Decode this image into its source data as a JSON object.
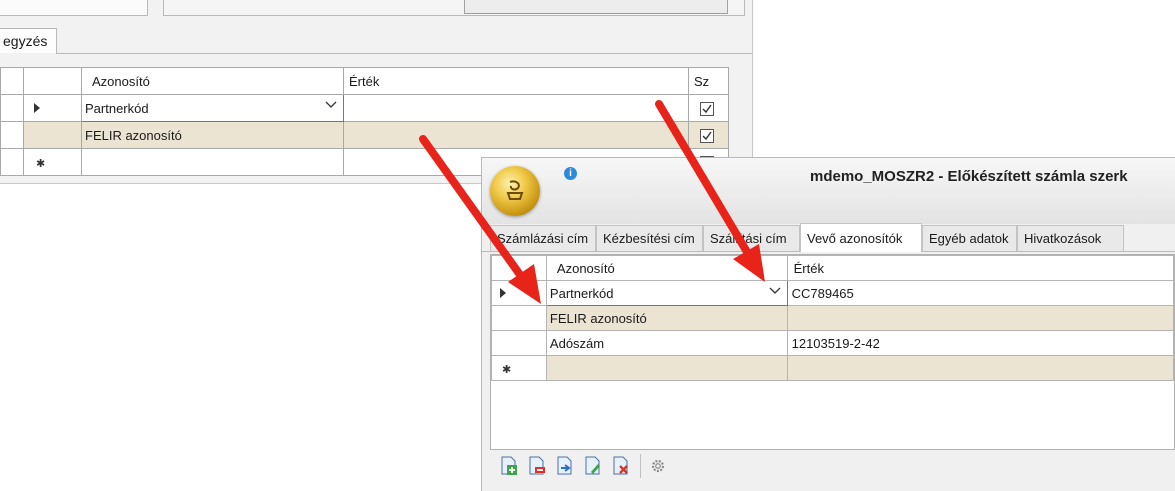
{
  "background_window": {
    "tab_label": "egyzés",
    "columns": {
      "id": "Azonosító",
      "value": "Érték",
      "sz": "Sz"
    },
    "rows": [
      {
        "azonosito": "Partnerkód",
        "ertek": "",
        "sz_checked": true
      },
      {
        "azonosito": "FELIR azonosító",
        "ertek": "",
        "sz_checked": true
      },
      {
        "azonosito": "",
        "ertek": "",
        "sz_checked": false
      }
    ]
  },
  "foreground_window": {
    "title": "mdemo_MOSZR2 - Előkészített számla szerk",
    "tabs": [
      {
        "label": "Számlázási cím",
        "active": false
      },
      {
        "label": "Kézbesítési cím",
        "active": false
      },
      {
        "label": "Szállítási cím",
        "active": false
      },
      {
        "label": "Vevő azonosítók",
        "active": true
      },
      {
        "label": "Egyéb adatok",
        "active": false
      },
      {
        "label": "Hivatkozások",
        "active": false
      }
    ],
    "columns": {
      "id": "Azonosító",
      "value": "Érték"
    },
    "rows": [
      {
        "azonosito": "Partnerkód",
        "ertek": "CC789465"
      },
      {
        "azonosito": "FELIR azonosító",
        "ertek": ""
      },
      {
        "azonosito": "Adószám",
        "ertek": "12103519-2-42"
      },
      {
        "azonosito": "",
        "ertek": ""
      }
    ],
    "toolbar_icons": [
      "add-row-icon",
      "delete-row-icon",
      "move-icon",
      "edit-icon",
      "cancel-icon",
      "settings-icon"
    ]
  },
  "colors": {
    "annotation_arrow": "#e8231a",
    "highlight_row": "#ece4d3",
    "active_cell_border": "#4a7fc1"
  }
}
